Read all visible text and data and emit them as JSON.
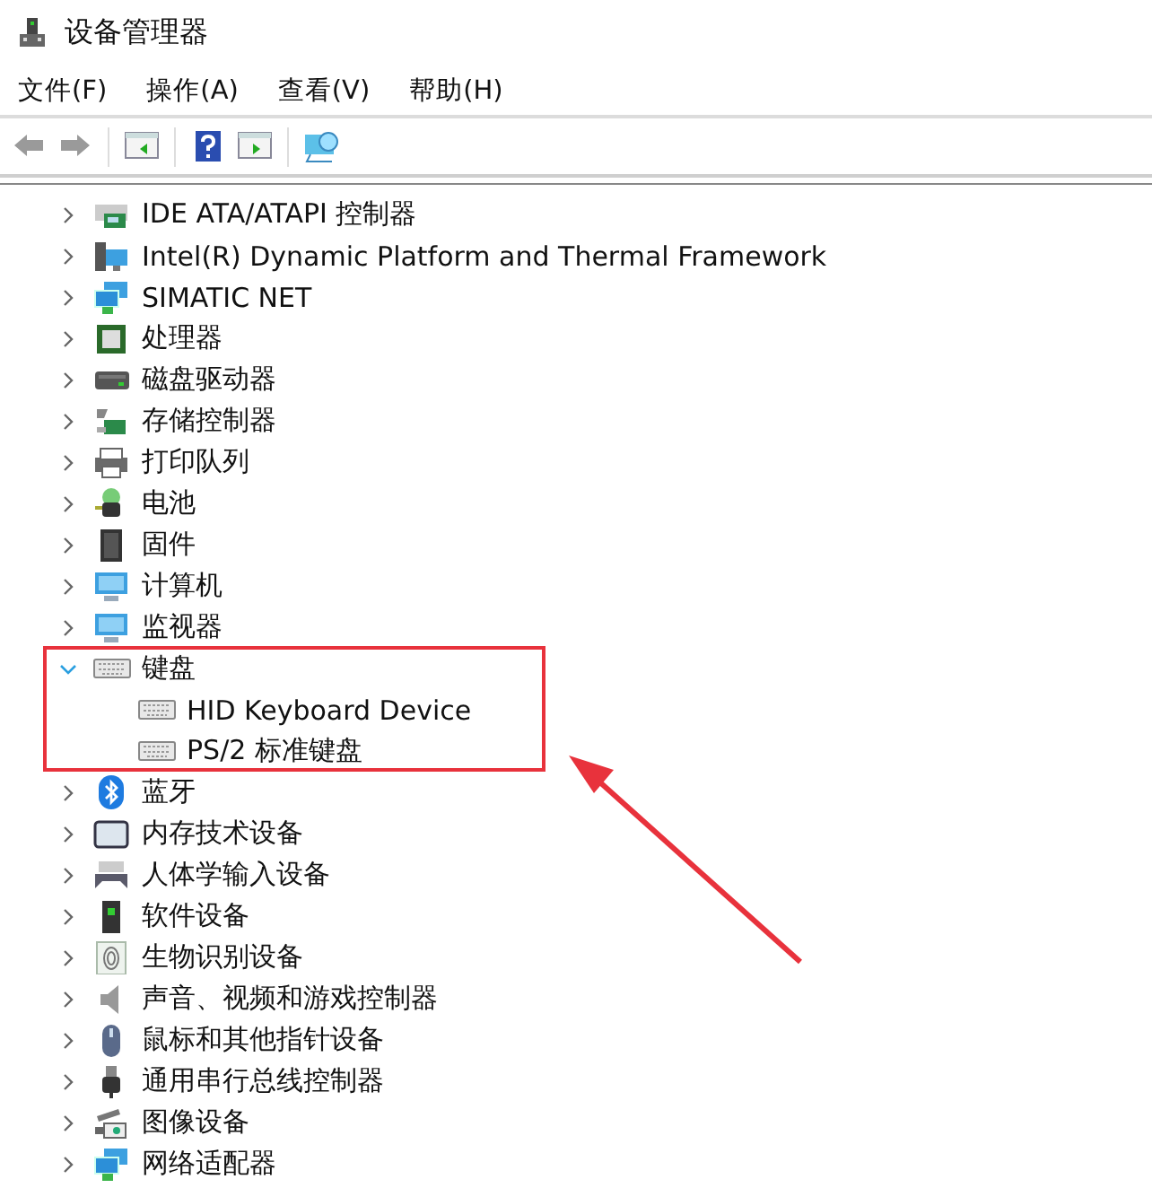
{
  "window": {
    "title": "设备管理器"
  },
  "menu": [
    "文件(F)",
    "操作(A)",
    "查看(V)",
    "帮助(H)"
  ],
  "tree": [
    {
      "label": "IDE ATA/ATAPI 控制器",
      "expanded": false
    },
    {
      "label": "Intel(R) Dynamic Platform and Thermal Framework",
      "expanded": false
    },
    {
      "label": "SIMATIC NET",
      "expanded": false
    },
    {
      "label": "处理器",
      "expanded": false
    },
    {
      "label": "磁盘驱动器",
      "expanded": false
    },
    {
      "label": "存储控制器",
      "expanded": false
    },
    {
      "label": "打印队列",
      "expanded": false
    },
    {
      "label": "电池",
      "expanded": false
    },
    {
      "label": "固件",
      "expanded": false
    },
    {
      "label": "计算机",
      "expanded": false
    },
    {
      "label": "监视器",
      "expanded": false
    },
    {
      "label": "键盘",
      "expanded": true,
      "children": [
        {
          "label": "HID Keyboard Device"
        },
        {
          "label": "PS/2 标准键盘"
        }
      ]
    },
    {
      "label": "蓝牙",
      "expanded": false
    },
    {
      "label": "内存技术设备",
      "expanded": false
    },
    {
      "label": "人体学输入设备",
      "expanded": false
    },
    {
      "label": "软件设备",
      "expanded": false
    },
    {
      "label": "生物识别设备",
      "expanded": false
    },
    {
      "label": "声音、视频和游戏控制器",
      "expanded": false
    },
    {
      "label": "鼠标和其他指针设备",
      "expanded": false
    },
    {
      "label": "通用串行总线控制器",
      "expanded": false
    },
    {
      "label": "图像设备",
      "expanded": false
    },
    {
      "label": "网络适配器",
      "expanded": false
    }
  ]
}
